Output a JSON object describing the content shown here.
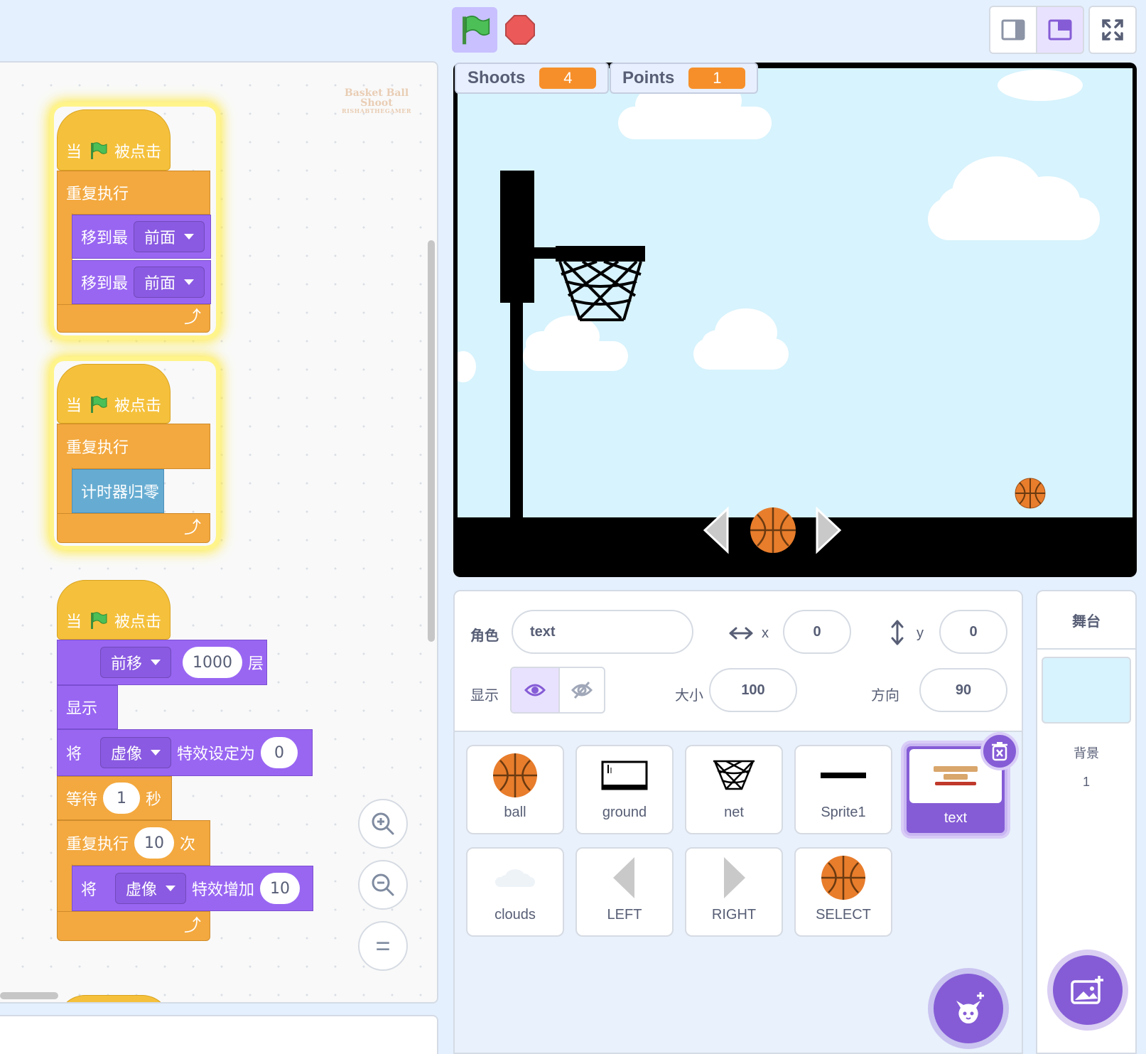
{
  "code": {
    "watermark": {
      "line1": "Basket Ball",
      "line2": "Shoot",
      "line3": "RISHABTHEGAMER"
    },
    "script1": {
      "hat": {
        "prefix": "当",
        "suffix": "被点击"
      },
      "forever": "重复执行",
      "goto1": {
        "label": "移到最",
        "option": "前面"
      },
      "goto2": {
        "label": "移到最",
        "option": "前面"
      }
    },
    "script2": {
      "hat": {
        "prefix": "当",
        "suffix": "被点击"
      },
      "forever": "重复执行",
      "reset_timer": "计时器归零"
    },
    "script3": {
      "hat": {
        "prefix": "当",
        "suffix": "被点击"
      },
      "layer": {
        "option": "前移",
        "value": "1000",
        "suffix": "层"
      },
      "show": "显示",
      "set_effect": {
        "prefix": "将",
        "option": "虚像",
        "mid": "特效设定为",
        "value": "0"
      },
      "wait": {
        "prefix": "等待",
        "value": "1",
        "suffix": "秒"
      },
      "repeat": {
        "prefix": "重复执行",
        "value": "10",
        "suffix": "次"
      },
      "change_effect": {
        "prefix": "将",
        "option": "虚像",
        "mid": "特效增加",
        "value": "10"
      }
    },
    "zoom": {
      "in": "zoom-in-icon",
      "out": "zoom-out-icon",
      "reset": "="
    }
  },
  "stage": {
    "monitors": [
      {
        "name": "Shoots",
        "value": "4"
      },
      {
        "name": "Points",
        "value": "1"
      }
    ]
  },
  "sprite_info": {
    "sprite_label": "角色",
    "sprite_name": "text",
    "x_label": "x",
    "x_value": "0",
    "y_label": "y",
    "y_value": "0",
    "show_label": "显示",
    "size_label": "大小",
    "size_value": "100",
    "direction_label": "方向",
    "direction_value": "90"
  },
  "sprites": [
    {
      "name": "ball",
      "icon": "basketball-icon"
    },
    {
      "name": "ground",
      "icon": "ground-icon"
    },
    {
      "name": "net",
      "icon": "net-icon"
    },
    {
      "name": "Sprite1",
      "icon": "line-icon"
    },
    {
      "name": "text",
      "icon": "title-text-icon",
      "selected": true
    },
    {
      "name": "clouds",
      "icon": "cloud-icon"
    },
    {
      "name": "LEFT",
      "icon": "left-arrow-icon"
    },
    {
      "name": "RIGHT",
      "icon": "right-arrow-icon"
    },
    {
      "name": "SELECT",
      "icon": "basketball-icon"
    }
  ],
  "stage_panel": {
    "title": "舞台",
    "backdrop_label": "背景",
    "backdrop_count": "1"
  },
  "colors": {
    "accent": "#855cd6",
    "events": "#f5c13c",
    "control": "#f3a93f",
    "looks": "#9966f2",
    "sensing": "#66acd2",
    "monitor_value": "#f68f2a",
    "sky": "#d7f3fd"
  }
}
